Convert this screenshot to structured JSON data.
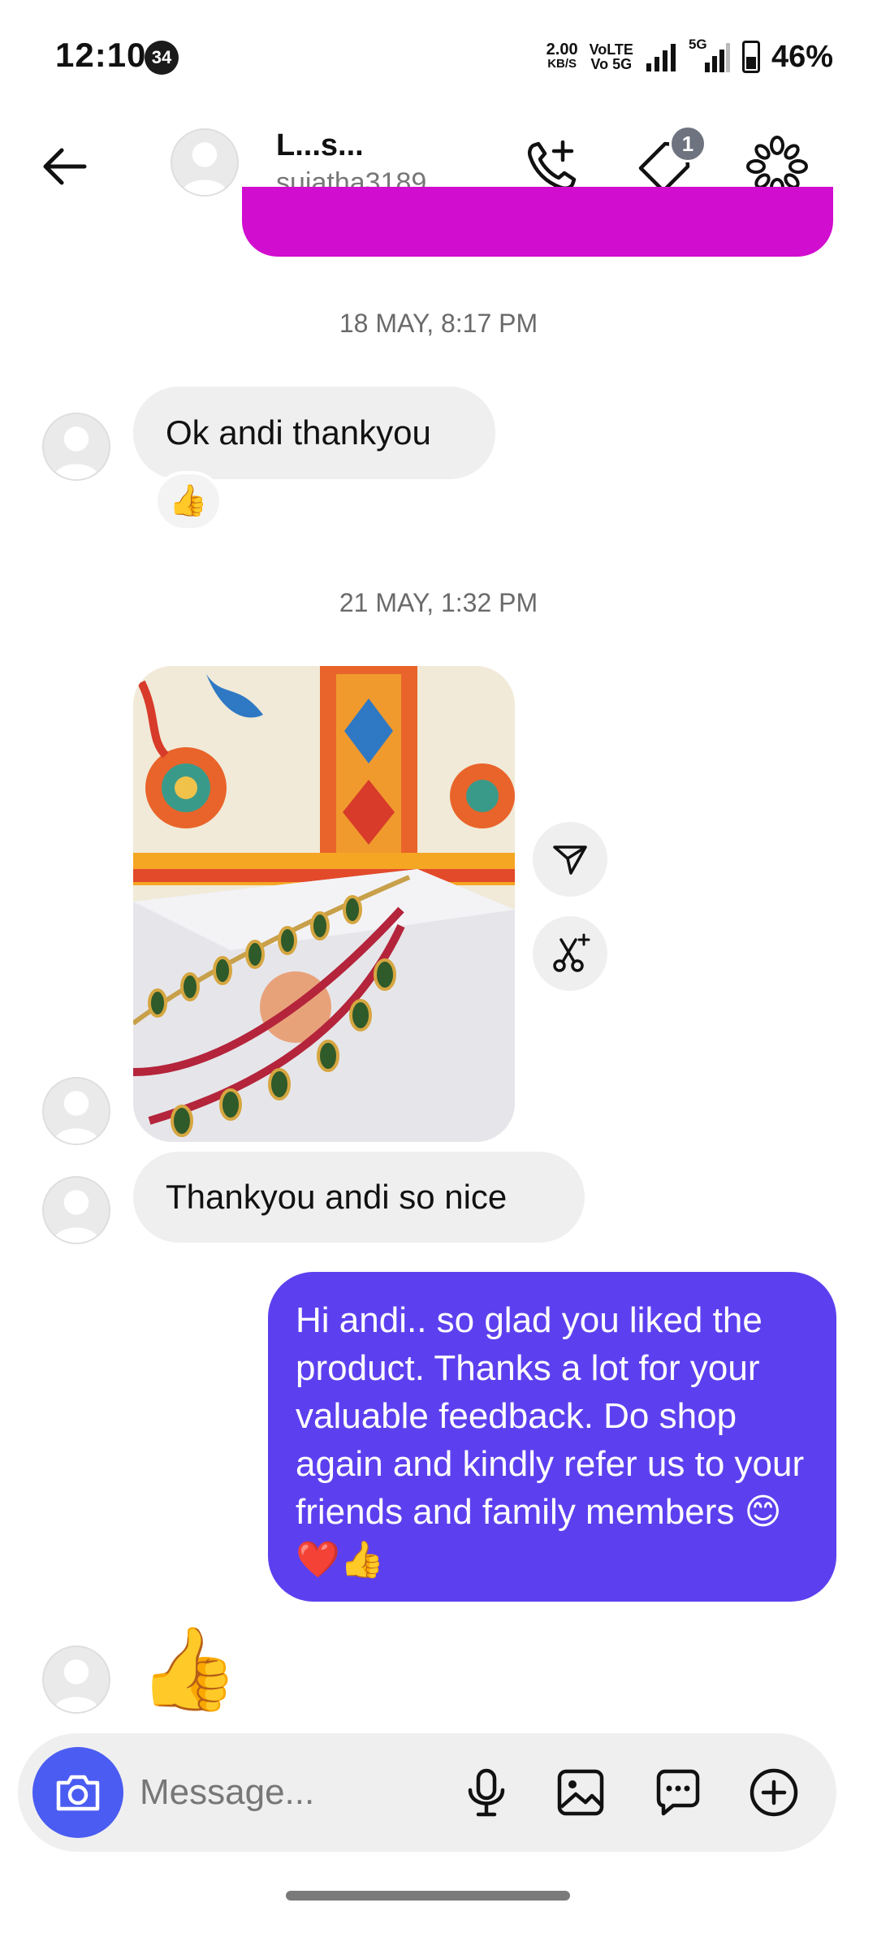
{
  "status_bar": {
    "time": "12:10",
    "notification_count": "34",
    "net_speed_value": "2.00",
    "net_speed_unit": "KB/S",
    "volte_top": "VoLTE",
    "volte_bottom": "Vo 5G",
    "network_label": "5G",
    "battery": "46%",
    "battery_level": 0.46
  },
  "header": {
    "contact_name": "L...s...",
    "username": "sujatha3189",
    "tag_badge": "1"
  },
  "messages": {
    "timestamp_1": "18 MAY, 8:17 PM",
    "incoming_1": "Ok andi thankyou",
    "reaction_1": "👍",
    "timestamp_2": "21 MAY, 1:32 PM",
    "incoming_2": "Thankyou andi so nice",
    "outgoing_1": "Hi andi.. so glad you liked the product. Thanks a lot for your valuable feedback. Do shop again and kindly refer us to your friends and family members 😊❤️👍",
    "incoming_like": "👍"
  },
  "composer": {
    "placeholder": "Message..."
  },
  "colors": {
    "outgoing_bubble": "#5c40ef",
    "previous_bubble": "#d10dcf",
    "camera_button": "#4b5cf2",
    "incoming_bubble": "#efefef"
  },
  "icons": {
    "back": "arrow-left-icon",
    "call": "phone-plus-icon",
    "tag": "tag-icon",
    "more": "flower-menu-icon",
    "camera": "camera-icon",
    "mic": "microphone-icon",
    "gallery": "image-icon",
    "sticker": "chat-sticker-icon",
    "plus": "plus-circle-icon",
    "share": "send-icon",
    "ai": "cut-sparkle-icon"
  }
}
